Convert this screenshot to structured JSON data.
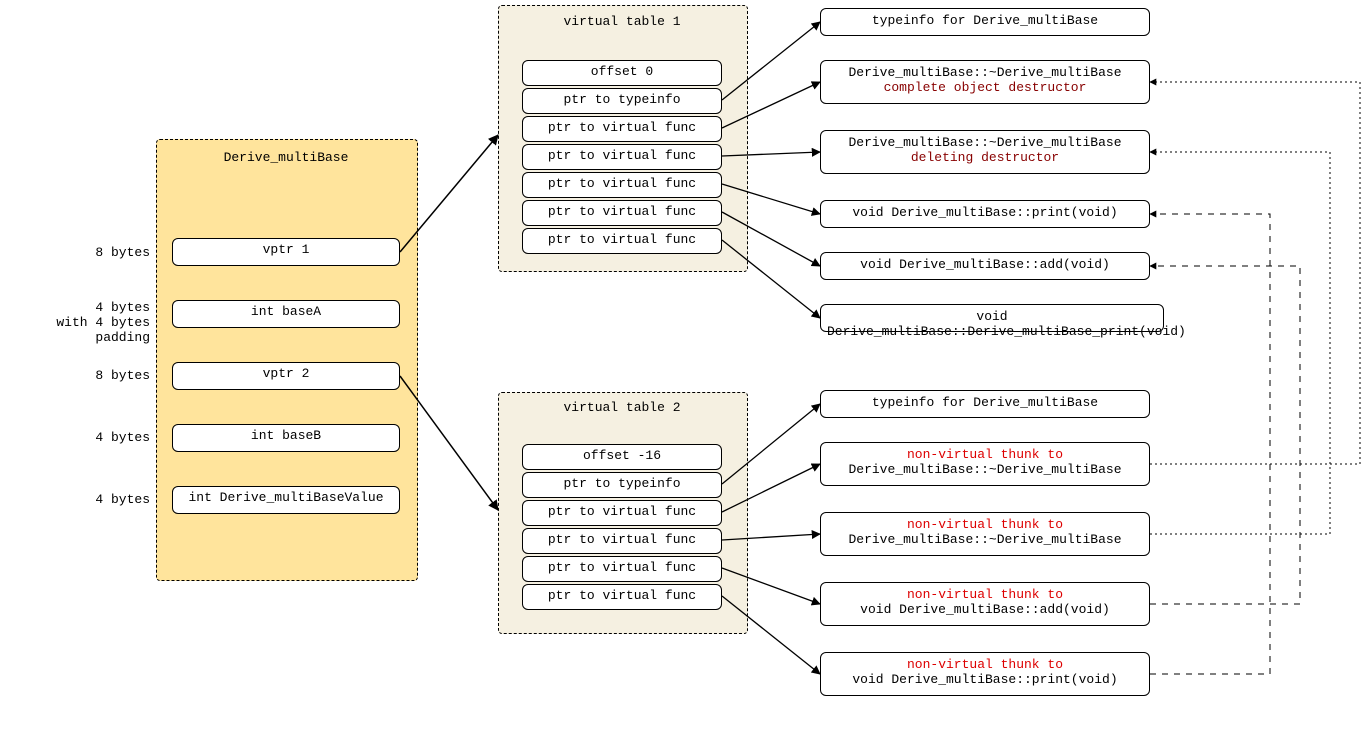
{
  "object": {
    "title": "Derive_multiBase",
    "fields": [
      {
        "size": "8 bytes",
        "name": "vptr 1"
      },
      {
        "size": "4 bytes\nwith 4 bytes padding",
        "name": "int baseA"
      },
      {
        "size": "8 bytes",
        "name": "vptr 2"
      },
      {
        "size": "4 bytes",
        "name": "int baseB"
      },
      {
        "size": "4 bytes",
        "name": "int Derive_multiBaseValue"
      }
    ]
  },
  "vt1": {
    "title": "virtual table 1",
    "rows": [
      "offset 0",
      "ptr to typeinfo",
      "ptr to virtual func",
      "ptr to virtual func",
      "ptr to virtual func",
      "ptr to virtual func",
      "ptr to virtual func"
    ]
  },
  "vt2": {
    "title": "virtual table 2",
    "rows": [
      "offset -16",
      "ptr to typeinfo",
      "ptr to virtual func",
      "ptr to virtual func",
      "ptr to virtual func",
      "ptr to virtual func"
    ]
  },
  "funcs1": {
    "typeinfo": "typeinfo for Derive_multiBase",
    "dtor_complete_l1": "Derive_multiBase::~Derive_multiBase",
    "dtor_complete_l2": "complete object destructor",
    "dtor_delete_l1": "Derive_multiBase::~Derive_multiBase",
    "dtor_delete_l2": "deleting destructor",
    "print": "void Derive_multiBase::print(void)",
    "add": "void Derive_multiBase::add(void)",
    "dprint": "void Derive_multiBase::Derive_multiBase_print(void)"
  },
  "funcs2": {
    "typeinfo": "typeinfo for Derive_multiBase",
    "thunk": "non-virtual thunk to",
    "dtor1": "Derive_multiBase::~Derive_multiBase",
    "dtor2": "Derive_multiBase::~Derive_multiBase",
    "add": "void Derive_multiBase::add(void)",
    "print": "void Derive_multiBase::print(void)"
  }
}
